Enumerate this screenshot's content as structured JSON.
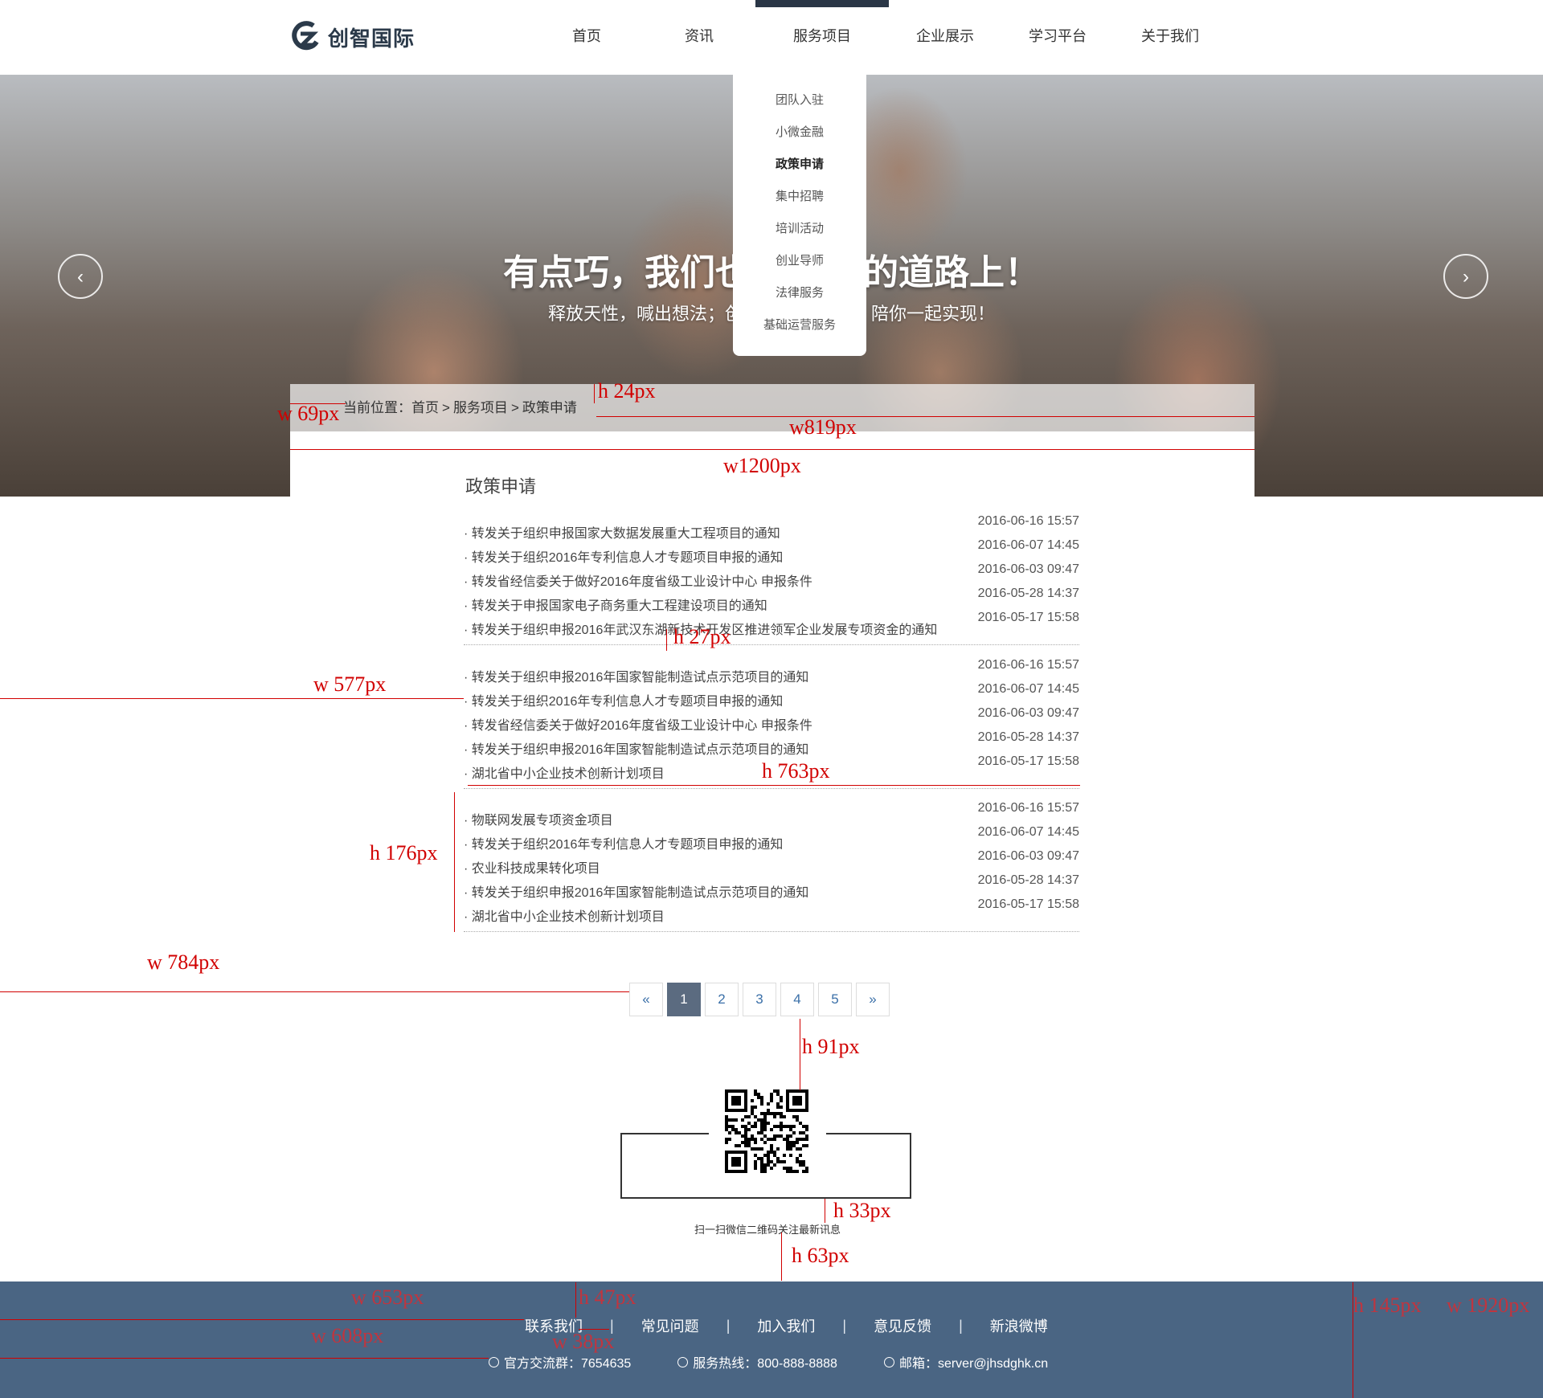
{
  "header": {
    "logo_text": "创智国际",
    "nav": [
      "首页",
      "资讯",
      "服务项目",
      "企业展示",
      "学习平台",
      "关于我们"
    ],
    "active_nav_index": 2,
    "dropdown": [
      "团队入驻",
      "小微金融",
      "政策申请",
      "集中招聘",
      "培训活动",
      "创业导师",
      "法律服务",
      "基础运营服务"
    ],
    "dropdown_current_index": 2
  },
  "banner": {
    "title": "有点巧，我们也",
    "title_tail": "的道路上！",
    "subtitle": "释放天性，喊出想法；创",
    "subtitle_tail": "陪你一起实现！",
    "prev_label": "‹",
    "next_label": "›"
  },
  "breadcrumb": {
    "prefix": "当前位置：",
    "items": [
      "首页",
      "服务项目",
      "政策申请"
    ],
    "separator": ">"
  },
  "section_title": "政策申请",
  "news_groups": [
    [
      {
        "title": "· 转发关于组织申报国家大数据发展重大工程项目的通知",
        "date": "2016-06-16 15:57"
      },
      {
        "title": "· 转发关于组织2016年专利信息人才专题项目申报的通知",
        "date": "2016-06-07 14:45"
      },
      {
        "title": "· 转发省经信委关于做好2016年度省级工业设计中心 申报条件",
        "date": "2016-06-03 09:47"
      },
      {
        "title": "· 转发关于申报国家电子商务重大工程建设项目的通知",
        "date": "2016-05-28 14:37"
      },
      {
        "title": "· 转发关于组织申报2016年武汉东湖新技术开发区推进领军企业发展专项资金的通知",
        "date": "2016-05-17 15:58"
      }
    ],
    [
      {
        "title": "· 转发关于组织申报2016年国家智能制造试点示范项目的通知",
        "date": "2016-06-16 15:57"
      },
      {
        "title": "· 转发关于组织2016年专利信息人才专题项目申报的通知",
        "date": "2016-06-07 14:45"
      },
      {
        "title": "· 转发省经信委关于做好2016年度省级工业设计中心 申报条件",
        "date": "2016-06-03 09:47"
      },
      {
        "title": "· 转发关于组织申报2016年国家智能制造试点示范项目的通知",
        "date": "2016-05-28 14:37"
      },
      {
        "title": "· 湖北省中小企业技术创新计划项目",
        "date": "2016-05-17 15:58"
      }
    ],
    [
      {
        "title": "· 物联网发展专项资金项目",
        "date": "2016-06-16 15:57"
      },
      {
        "title": "· 转发关于组织2016年专利信息人才专题项目申报的通知",
        "date": "2016-06-07 14:45"
      },
      {
        "title": "· 农业科技成果转化项目",
        "date": "2016-06-03 09:47"
      },
      {
        "title": "· 转发关于组织申报2016年国家智能制造试点示范项目的通知",
        "date": "2016-05-28 14:37"
      },
      {
        "title": "· 湖北省中小企业技术创新计划项目",
        "date": "2016-05-17 15:58"
      }
    ]
  ],
  "pagination": {
    "prev": "«",
    "pages": [
      "1",
      "2",
      "3",
      "4",
      "5"
    ],
    "active_index": 0,
    "next": "»"
  },
  "qr_caption": "扫一扫微信二维码关注最新讯息",
  "footer": {
    "links": [
      "联系我们",
      "常见问题",
      "加入我们",
      "意见反馈",
      "新浪微博"
    ],
    "divider": "|",
    "info": [
      {
        "icon": "qq-icon",
        "text": "官方交流群：7654635"
      },
      {
        "icon": "phone-icon",
        "text": "服务热线：800-888-8888"
      },
      {
        "icon": "mail-icon",
        "text": "邮箱：server@jhsdghk.cn"
      }
    ]
  },
  "annotations": [
    "h 24px",
    "w 69px",
    "w819px",
    "w1200px",
    "h 27px",
    "w 577px",
    "h 763px",
    "h 176px",
    "w 784px",
    "h 91px",
    "h 33px",
    "h 63px",
    "w 653px",
    "h 47px",
    "w 608px",
    "w 38px",
    "h 145px",
    "w 1920px"
  ],
  "colors": {
    "footer_bg": "#4a6583",
    "annotation": "#d10000",
    "active_page": "#5b6b80"
  }
}
